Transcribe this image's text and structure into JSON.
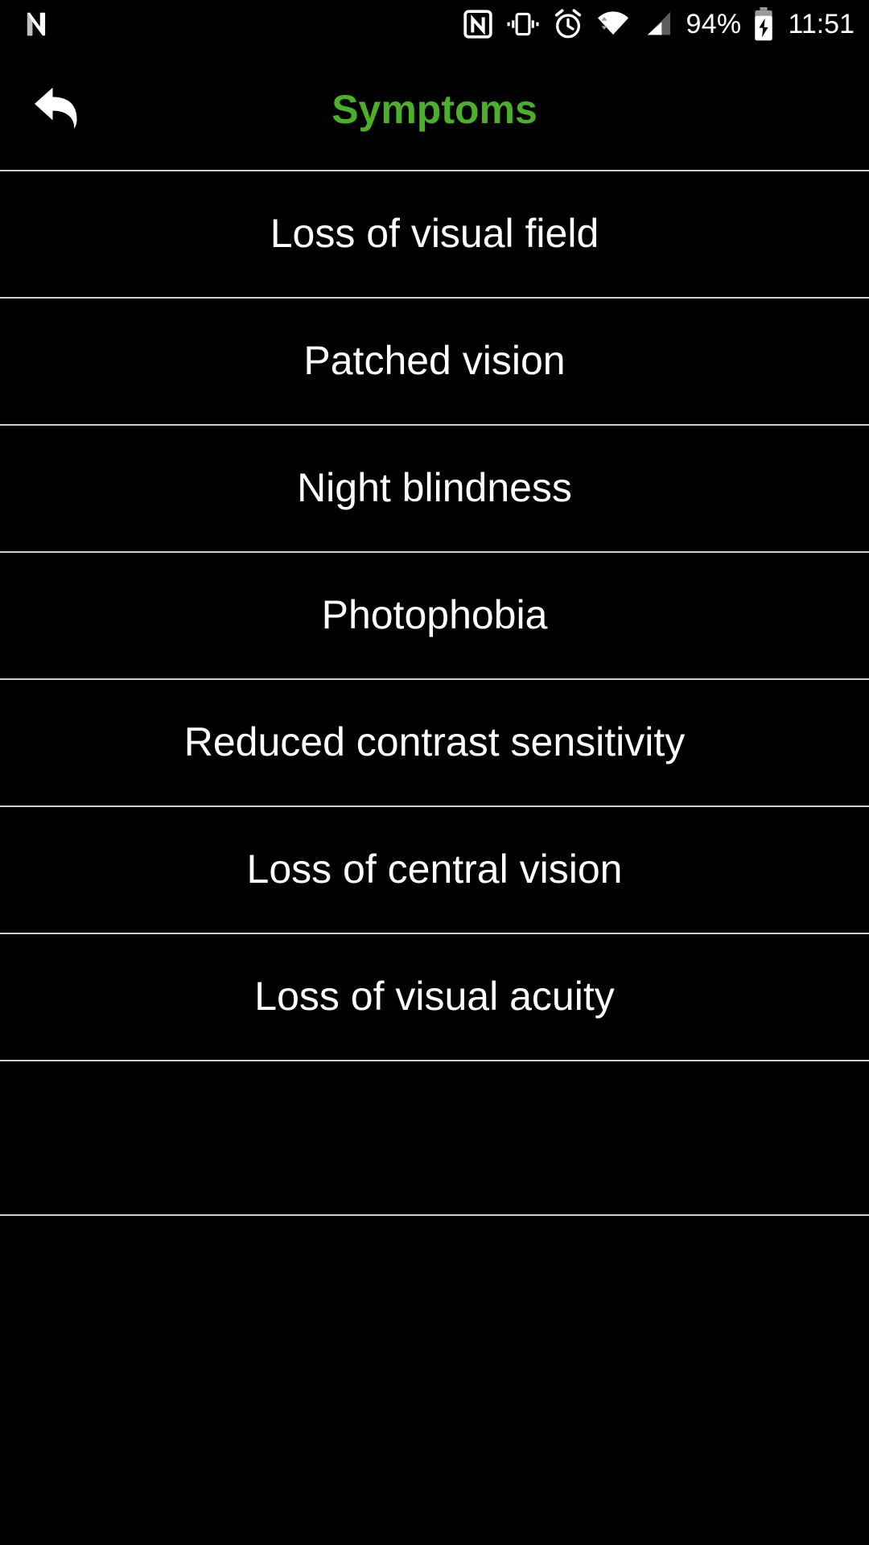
{
  "status_bar": {
    "left_icons": [
      {
        "name": "app-notification-icon",
        "label": "N"
      }
    ],
    "right_icons": [
      {
        "name": "nfc-icon",
        "label": "NFC"
      },
      {
        "name": "vibrate-icon",
        "label": "Vibrate"
      },
      {
        "name": "alarm-icon",
        "label": "Alarm set"
      },
      {
        "name": "wifi-icon",
        "label": "Wi-Fi connected"
      },
      {
        "name": "cellular-signal-icon",
        "label": "Cellular signal"
      }
    ],
    "battery_percent": "94%",
    "battery_state": "charging",
    "time": "11:51"
  },
  "app_bar": {
    "back_icon": "back-arrow-icon",
    "title": "Symptoms",
    "title_color": "#4CAF2A"
  },
  "list": {
    "items": [
      {
        "label": "Loss of visual field"
      },
      {
        "label": "Patched vision"
      },
      {
        "label": "Night blindness"
      },
      {
        "label": "Photophobia"
      },
      {
        "label": "Reduced contrast sensitivity"
      },
      {
        "label": "Loss of central vision"
      },
      {
        "label": "Loss of visual acuity"
      }
    ]
  },
  "colors": {
    "background": "#000000",
    "text": "#FFFFFF",
    "accent": "#4CAF2A",
    "divider": "#CCCCCC"
  }
}
